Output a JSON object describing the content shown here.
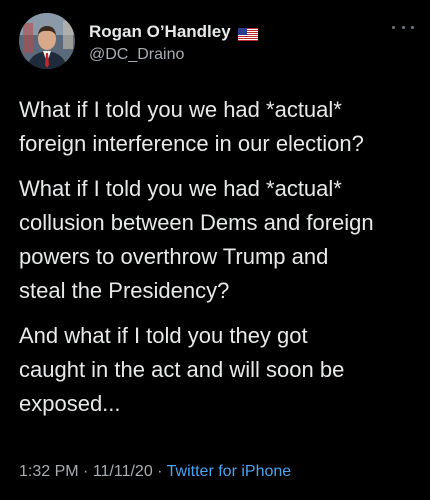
{
  "author": {
    "display_name": "Rogan O’Handley",
    "flag_icon": "us-flag-icon",
    "handle": "@DC_Draino"
  },
  "tweet": {
    "paragraphs": [
      [
        "What if I told you we had *actual*",
        "foreign interference in our election?"
      ],
      [
        "What if I told you we had *actual*",
        "collusion between Dems and foreign",
        "powers to overthrow Trump and",
        "steal the Presidency?"
      ],
      [
        "And what if I told you they got",
        "caught in the act and will soon be",
        "exposed..."
      ]
    ]
  },
  "meta": {
    "time": "1:32 PM",
    "separator": " · ",
    "date": "11/11/20",
    "source": "Twitter for iPhone"
  },
  "colors": {
    "background": "#000000",
    "text": "#e7e9ea",
    "secondary": "#a8adb2",
    "link": "#4aa3f0"
  }
}
